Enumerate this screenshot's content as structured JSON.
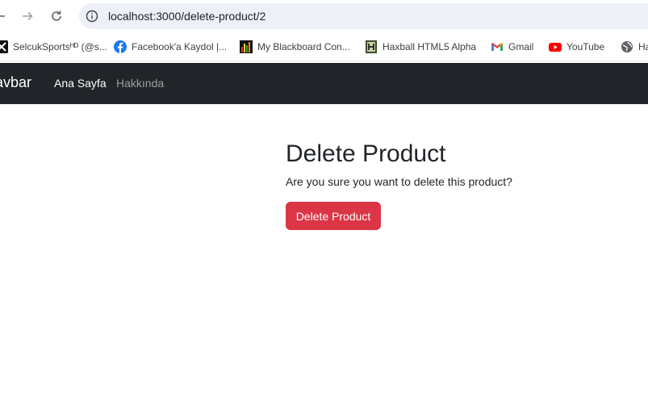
{
  "browser": {
    "url": "localhost:3000/delete-product/2"
  },
  "bookmarks": [
    {
      "label": "SelcukSportsᴴᴰ (@s...",
      "icon": "selcuksports-icon"
    },
    {
      "label": "Facebook'a Kaydol |...",
      "icon": "facebook-icon"
    },
    {
      "label": "My Blackboard Con...",
      "icon": "blackboard-icon"
    },
    {
      "label": "Haxball HTML5 Alpha",
      "icon": "haxball-icon"
    },
    {
      "label": "Gmail",
      "icon": "gmail-icon"
    },
    {
      "label": "YouTube",
      "icon": "youtube-icon"
    },
    {
      "label": "Ha",
      "icon": "globe-icon"
    }
  ],
  "navbar": {
    "brand": "avbar",
    "links": [
      "Ana Sayfa",
      "Hakkında"
    ]
  },
  "main": {
    "title": "Delete Product",
    "message": "Are you sure you want to delete this product?",
    "button_label": "Delete Product"
  },
  "colors": {
    "navbar_bg": "#212529",
    "danger": "#dc3545",
    "facebook": "#1877f2",
    "youtube": "#ff0000"
  }
}
